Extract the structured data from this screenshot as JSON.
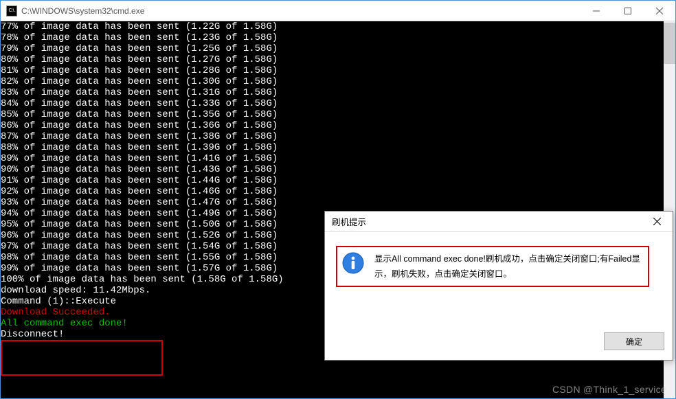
{
  "window": {
    "title": "C:\\WINDOWS\\system32\\cmd.exe",
    "icon_label": "C:\\."
  },
  "console": {
    "progress_lines": [
      "77% of image data has been sent (1.22G of 1.58G)",
      "78% of image data has been sent (1.23G of 1.58G)",
      "79% of image data has been sent (1.25G of 1.58G)",
      "80% of image data has been sent (1.27G of 1.58G)",
      "81% of image data has been sent (1.28G of 1.58G)",
      "82% of image data has been sent (1.30G of 1.58G)",
      "83% of image data has been sent (1.31G of 1.58G)",
      "84% of image data has been sent (1.33G of 1.58G)",
      "85% of image data has been sent (1.35G of 1.58G)",
      "86% of image data has been sent (1.36G of 1.58G)",
      "87% of image data has been sent (1.38G of 1.58G)",
      "88% of image data has been sent (1.39G of 1.58G)",
      "89% of image data has been sent (1.41G of 1.58G)",
      "90% of image data has been sent (1.43G of 1.58G)",
      "91% of image data has been sent (1.44G of 1.58G)",
      "92% of image data has been sent (1.46G of 1.58G)",
      "93% of image data has been sent (1.47G of 1.58G)",
      "94% of image data has been sent (1.49G of 1.58G)",
      "95% of image data has been sent (1.50G of 1.58G)",
      "96% of image data has been sent (1.52G of 1.58G)",
      "97% of image data has been sent (1.54G of 1.58G)",
      "98% of image data has been sent (1.55G of 1.58G)",
      "99% of image data has been sent (1.57G of 1.58G)",
      "100% of image data has been sent (1.58G of 1.58G)"
    ],
    "speed_line": "download speed: 11.42Mbps.",
    "command_line": "Command (1)::Execute",
    "success_line": "Download Succeeded.",
    "done_line": "All command exec done!",
    "disconnect_line": "Disconnect!"
  },
  "dialog": {
    "title": "刷机提示",
    "message": "显示All command exec done!刷机成功，点击确定关闭窗口;有Failed显示，刷机失败，点击确定关闭窗口。",
    "ok_label": "确定"
  },
  "watermark": "CSDN @Think_1_service"
}
